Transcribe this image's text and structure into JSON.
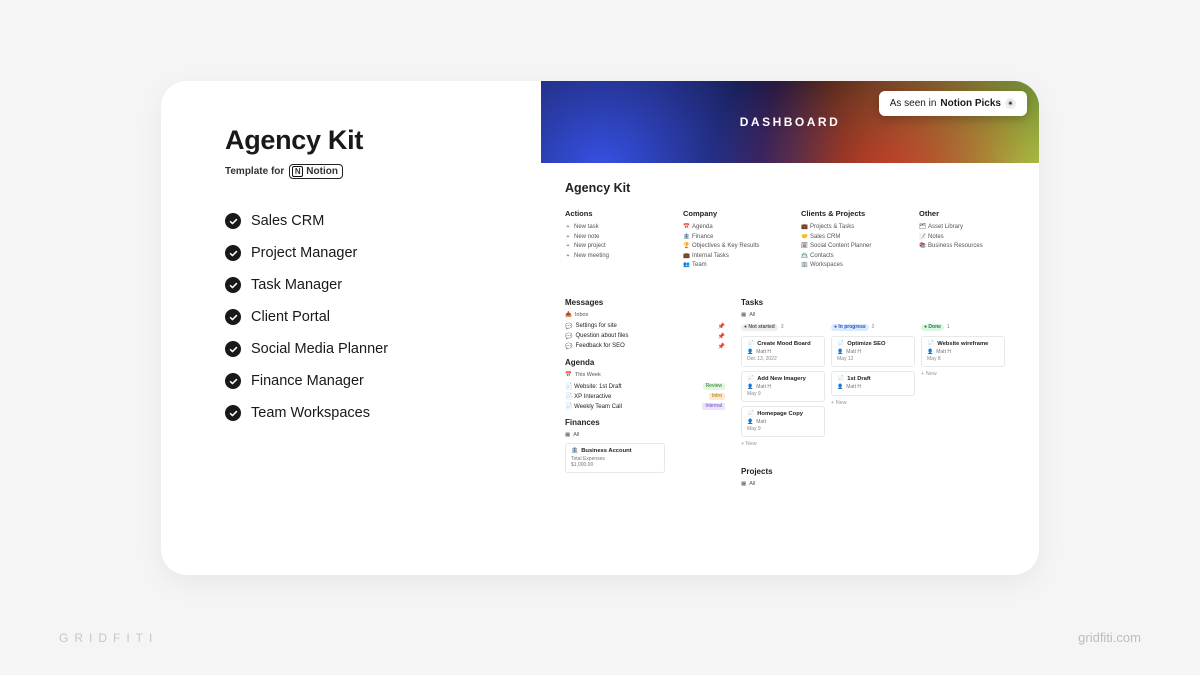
{
  "brand": {
    "left": "GRIDFITI",
    "right": "gridfiti.com"
  },
  "product": {
    "title": "Agency Kit",
    "subtitle_prefix": "Template for",
    "platform_name": "Notion"
  },
  "features": [
    "Sales CRM",
    "Project Manager",
    "Task Manager",
    "Client Portal",
    "Social Media Planner",
    "Finance Manager",
    "Team Workspaces"
  ],
  "badge": {
    "prefix": "As seen in",
    "name": "Notion Picks"
  },
  "dashboard": {
    "banner_title": "DASHBOARD",
    "page_title": "Agency Kit",
    "columns": {
      "actions": {
        "title": "Actions",
        "items": [
          "New task",
          "New note",
          "New project",
          "New meeting"
        ]
      },
      "company": {
        "title": "Company",
        "items": [
          "Agenda",
          "Finance",
          "Objectives & Key Results",
          "Internal Tasks",
          "Team"
        ]
      },
      "clients": {
        "title": "Clients & Projects",
        "items": [
          "Projects & Tasks",
          "Sales CRM",
          "Social Content Planner",
          "Contacts",
          "Workspaces"
        ]
      },
      "other": {
        "title": "Other",
        "items": [
          "Asset Library",
          "Notes",
          "Business Resources"
        ]
      }
    },
    "messages": {
      "title": "Messages",
      "view": "Inbox",
      "items": [
        "Settings for site",
        "Question about files",
        "Feedback for SEO"
      ]
    },
    "agenda": {
      "title": "Agenda",
      "view": "This Week",
      "items": [
        {
          "label": "Website: 1st Draft",
          "tag": "Review",
          "tag_style": "review"
        },
        {
          "label": "XP Interactive",
          "tag": "Intro",
          "tag_style": "intro"
        },
        {
          "label": "Weekly Team Call",
          "tag": "Internal",
          "tag_style": "internal"
        }
      ]
    },
    "tasks": {
      "title": "Tasks",
      "view": "All",
      "columns": [
        {
          "status": "Not started",
          "style": "grey",
          "count": 3,
          "cards": [
            {
              "title": "Create Mood Board",
              "assignee": "Matt H",
              "date": "Dec 13, 2022"
            },
            {
              "title": "Add New Imagery",
              "assignee": "Matt H",
              "date": "May 9"
            },
            {
              "title": "Homepage Copy",
              "assignee": "Matt",
              "date": "May 9"
            }
          ],
          "new": "+ New"
        },
        {
          "status": "In progress",
          "style": "blue",
          "count": 2,
          "cards": [
            {
              "title": "Optimize SEO",
              "assignee": "Matt H",
              "date": "May 12"
            },
            {
              "title": "1st Draft",
              "assignee": "Matt H",
              "date": ""
            }
          ],
          "new": "+ New"
        },
        {
          "status": "Done",
          "style": "green",
          "count": 1,
          "cards": [
            {
              "title": "Website wireframe",
              "assignee": "Matt H",
              "date": "May 8"
            }
          ],
          "new": "+ New"
        }
      ]
    },
    "finances": {
      "title": "Finances",
      "view": "All",
      "card": {
        "name": "Business Account",
        "line1": "Total Expenses",
        "line2": "$1,000.00"
      }
    },
    "projects": {
      "title": "Projects",
      "view": "All"
    }
  }
}
